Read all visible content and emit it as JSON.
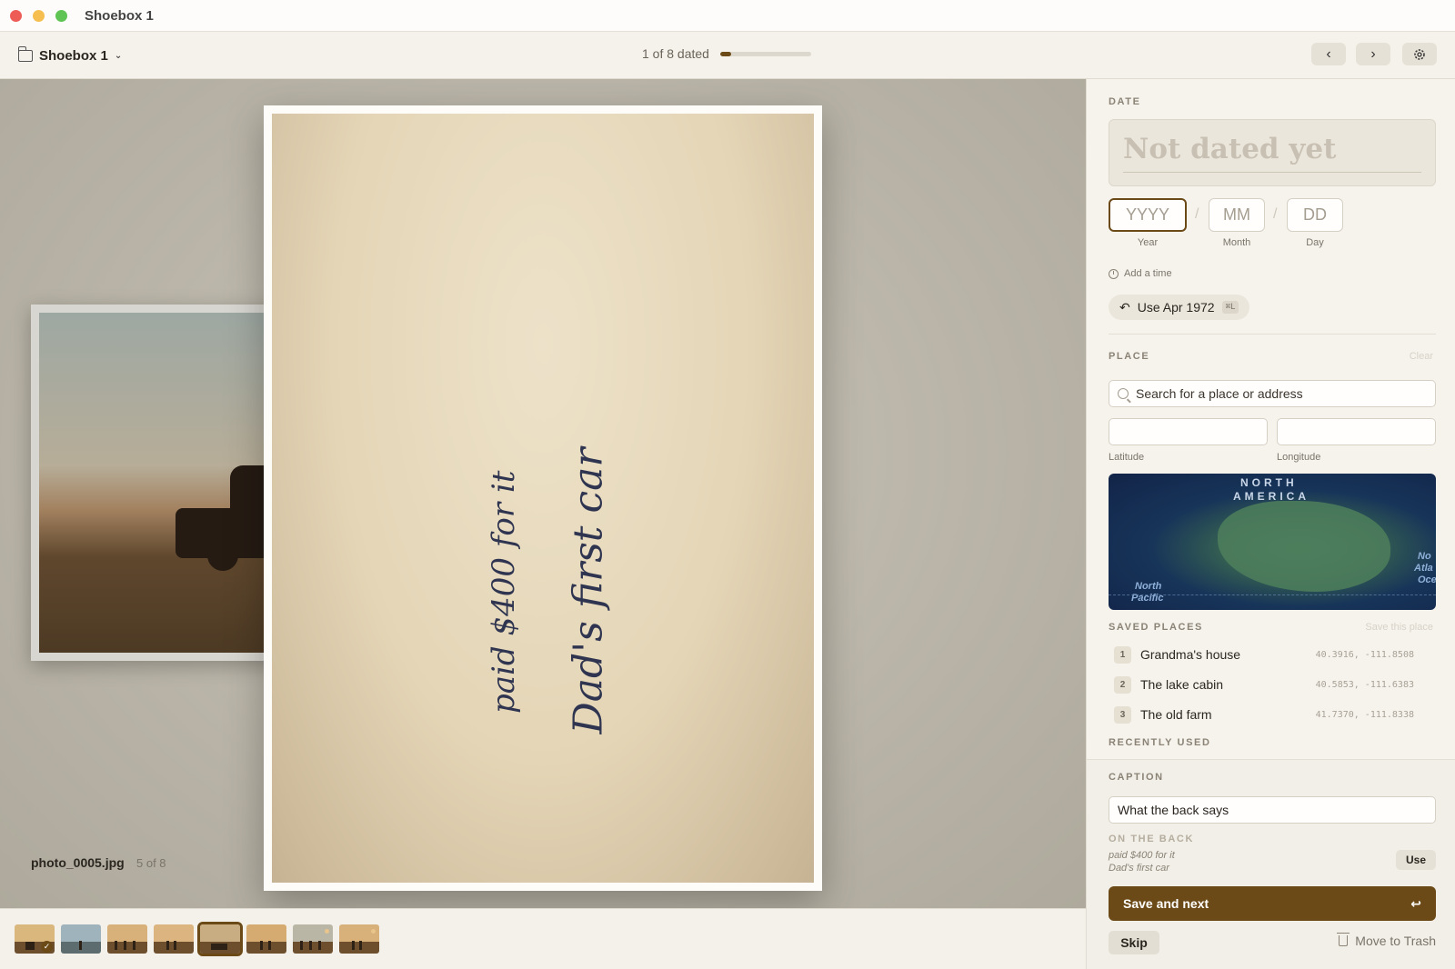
{
  "window": {
    "title": "Shoebox 1"
  },
  "toolbar": {
    "folder_label": "Shoebox 1",
    "progress_label": "1 of 8 dated",
    "progress_fraction": 0.125,
    "back_icon": "chevron-left-icon",
    "forward_icon": "chevron-right-icon",
    "settings_icon": "gear-icon"
  },
  "photo": {
    "filename": "photo_0005.jpg",
    "position": "5 of 8",
    "back_lines": [
      "paid $400 for it",
      "Dad's first car"
    ]
  },
  "filmstrip": {
    "count": 8,
    "active_index": 4,
    "dated_index": 0
  },
  "date": {
    "section_label": "DATE",
    "display": "Not dated yet",
    "year_placeholder": "YYYY",
    "month_placeholder": "MM",
    "day_placeholder": "DD",
    "year_label": "Year",
    "month_label": "Month",
    "day_label": "Day",
    "add_time": "Add a time",
    "suggestion": "Use Apr 1972",
    "suggestion_shortcut": "⌘L"
  },
  "place": {
    "section_label": "PLACE",
    "clear": "Clear",
    "search_placeholder": "Search for a place or address",
    "latitude_label": "Latitude",
    "longitude_label": "Longitude",
    "map_labels": {
      "continent_line1": "NORTH",
      "continent_line2": "AMERICA",
      "ocean_west1": "North",
      "ocean_west2": "Pacific",
      "ocean_east1": "No",
      "ocean_east2": "Atla",
      "ocean_east3": "Oce"
    },
    "saved_label": "SAVED PLACES",
    "save_this": "Save this place",
    "saved": [
      {
        "num": "1",
        "name": "Grandma's house",
        "coords": "40.3916, -111.8508"
      },
      {
        "num": "2",
        "name": "The lake cabin",
        "coords": "40.5853, -111.6383"
      },
      {
        "num": "3",
        "name": "The old farm",
        "coords": "41.7370, -111.8338"
      }
    ],
    "recent_label": "RECENTLY USED"
  },
  "caption": {
    "section_label": "CAPTION",
    "placeholder": "What the back says",
    "on_back_label": "ON THE BACK",
    "back_line1": "paid $400 for it",
    "back_line2": "Dad's first car",
    "use": "Use",
    "save_next": "Save and next",
    "skip": "Skip",
    "trash": "Move to Trash"
  },
  "colors": {
    "accent": "#6b4a17"
  }
}
